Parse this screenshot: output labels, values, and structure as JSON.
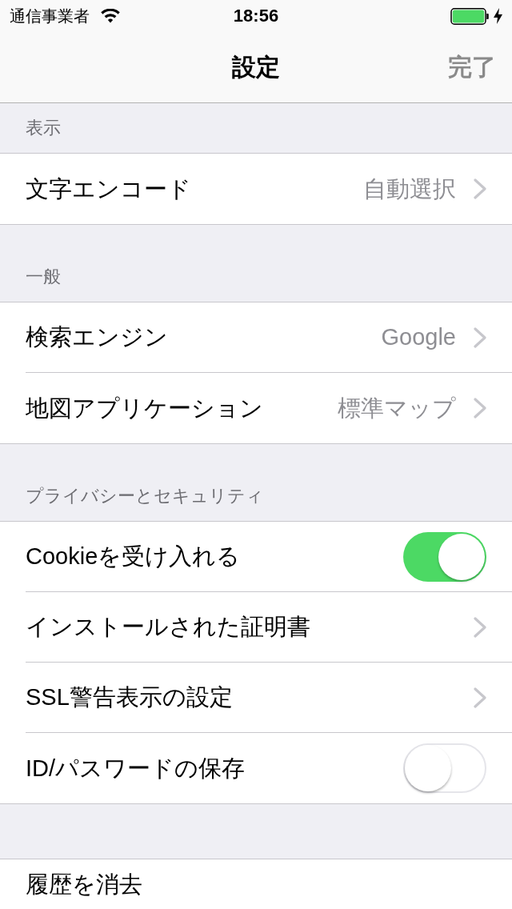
{
  "status_bar": {
    "carrier": "通信事業者",
    "time": "18:56"
  },
  "nav_bar": {
    "title": "設定",
    "done": "完了"
  },
  "sections": [
    {
      "header": "表示",
      "items": [
        {
          "kind": "disclosure",
          "label": "文字エンコード",
          "value": "自動選択"
        }
      ]
    },
    {
      "header": "一般",
      "items": [
        {
          "kind": "disclosure",
          "label": "検索エンジン",
          "value": "Google"
        },
        {
          "kind": "disclosure",
          "label": "地図アプリケーション",
          "value": "標準マップ"
        }
      ]
    },
    {
      "header": "プライバシーとセキュリティ",
      "items": [
        {
          "kind": "toggle",
          "label": "Cookieを受け入れる",
          "on": true
        },
        {
          "kind": "disclosure",
          "label": "インストールされた証明書"
        },
        {
          "kind": "disclosure",
          "label": "SSL警告表示の設定"
        },
        {
          "kind": "toggle",
          "label": "ID/パスワードの保存",
          "on": false
        }
      ]
    },
    {
      "items": [
        {
          "kind": "action",
          "label": "履歴を消去"
        }
      ]
    }
  ]
}
